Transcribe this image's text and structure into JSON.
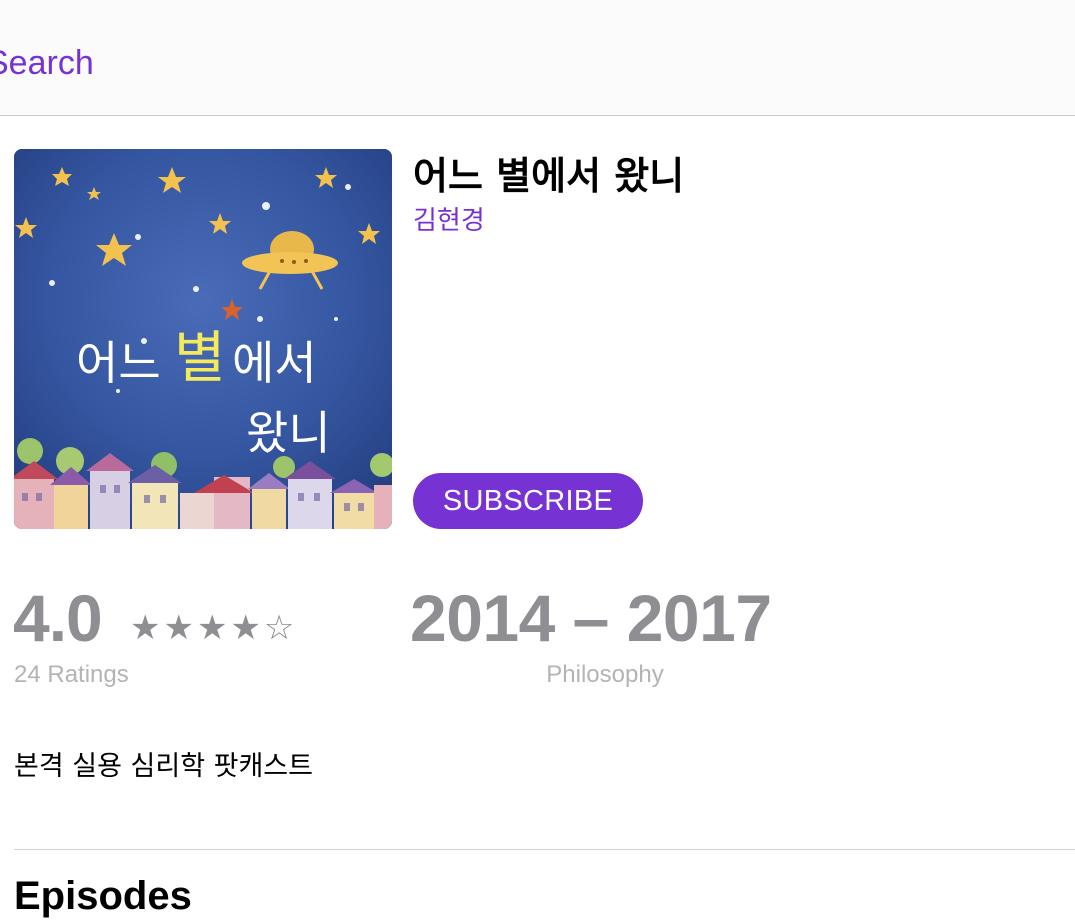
{
  "navbar": {
    "back_label": "Search",
    "accent_color": "#7632d3"
  },
  "podcast": {
    "title": "어느 별에서 왔니",
    "author": "김현경",
    "subscribe_label": "SUBSCRIBE",
    "artwork": {
      "description_icon": "podcast-artwork",
      "line1_a": "어느",
      "line1_b": "별",
      "line1_c": "에서",
      "line2": "왔니"
    }
  },
  "rating": {
    "value": "4.0",
    "stars": "★★★★☆",
    "stars_out_of_5": 4,
    "count_label": "24 Ratings"
  },
  "years": {
    "range": "2014 – 2017",
    "genre": "Philosophy"
  },
  "description": "본격 실용 심리학 팟캐스트",
  "sections": {
    "episodes_title": "Episodes"
  }
}
